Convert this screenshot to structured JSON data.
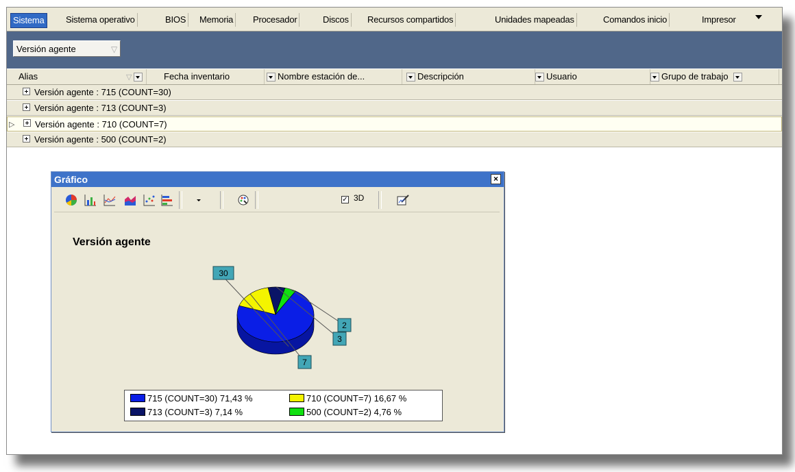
{
  "tabs": [
    {
      "label": "Sistema",
      "active": true
    },
    {
      "label": "Sistema operativo"
    },
    {
      "label": "BIOS"
    },
    {
      "label": "Memoria"
    },
    {
      "label": "Procesador"
    },
    {
      "label": "Discos"
    },
    {
      "label": "Recursos compartidos"
    },
    {
      "label": "Unidades mapeadas"
    },
    {
      "label": "Comandos inicio"
    },
    {
      "label": "Impresor"
    }
  ],
  "group_panel": {
    "chip_label": "Versión agente"
  },
  "columns": [
    {
      "label": "Alias"
    },
    {
      "label": "Fecha inventario"
    },
    {
      "label": "Nombre estación de..."
    },
    {
      "label": "Descripción"
    },
    {
      "label": "Usuario"
    },
    {
      "label": "Grupo de trabajo"
    }
  ],
  "group_rows": [
    {
      "label": "Versión agente : 715 (COUNT=30)"
    },
    {
      "label": "Versión agente : 713 (COUNT=3)"
    },
    {
      "label": "Versión agente : 710 (COUNT=7)",
      "selected": true
    },
    {
      "label": "Versión agente : 500 (COUNT=2)"
    }
  ],
  "dialog": {
    "title": "Gráfico",
    "close_label": "×",
    "toolbar_3d_label": "3D",
    "toolbar_3d_checked": true,
    "toolbar_3d_check": "✓"
  },
  "chart_data": {
    "type": "pie",
    "title": "Versión agente",
    "three_d": true,
    "slices": [
      {
        "label": "715 (COUNT=30) 71,43 %",
        "value": 30,
        "percent": 71.43,
        "data_label": "30",
        "color": "#0a1ee6"
      },
      {
        "label": "713 (COUNT=3) 7,14 %",
        "value": 3,
        "percent": 7.14,
        "data_label": "3",
        "color": "#0a1466"
      },
      {
        "label": "710 (COUNT=7) 16,67 %",
        "value": 7,
        "percent": 16.67,
        "data_label": "7",
        "color": "#f4f400"
      },
      {
        "label": "500 (COUNT=2) 4,76 %",
        "value": 2,
        "percent": 4.76,
        "data_label": "2",
        "color": "#10e010"
      }
    ]
  }
}
